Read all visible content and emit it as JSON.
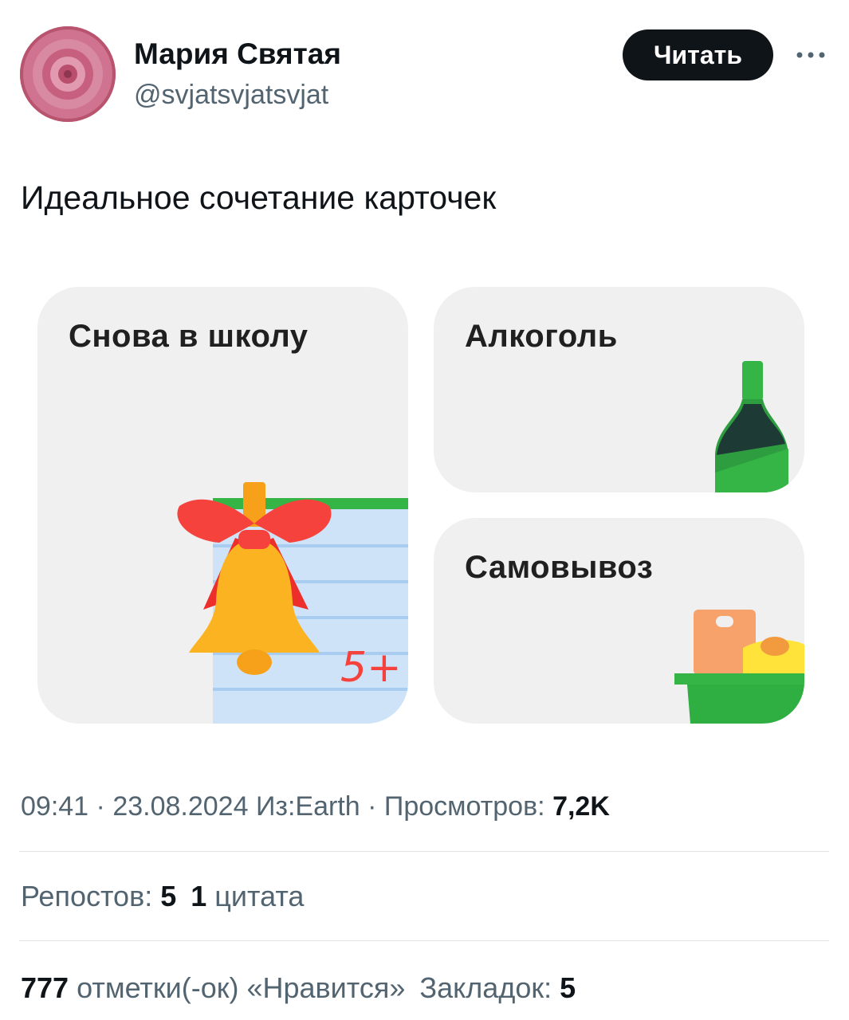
{
  "author": {
    "name": "Мария Святая",
    "handle": "@svjatsvjatsvjat",
    "follow_label": "Читать"
  },
  "tweet": {
    "text": "Идеальное сочетание карточек"
  },
  "media": {
    "cards": [
      {
        "title": "Снова в школу",
        "badge": "5+"
      },
      {
        "title": "Алкоголь"
      },
      {
        "title": "Самовывоз"
      }
    ]
  },
  "meta": {
    "time": "09:41",
    "separator": " · ",
    "date": "23.08.2024",
    "source": "Из:Earth",
    "views_label": "Просмотров:",
    "views_value": "7,2K"
  },
  "stats": {
    "reposts_label": "Репостов:",
    "reposts_value": "5",
    "quotes_value": "1",
    "quotes_label": "цитата",
    "likes_value": "777",
    "likes_label": "отметки(-ок) «Нравится»",
    "bookmarks_label": "Закладок:",
    "bookmarks_value": "5"
  },
  "colors": {
    "follow_bg": "#0f1419",
    "secondary_text": "#536471",
    "card_bg": "#f0f0f0",
    "green": "#35b546",
    "bell": "#fbb321",
    "bow": "#f6423c"
  }
}
